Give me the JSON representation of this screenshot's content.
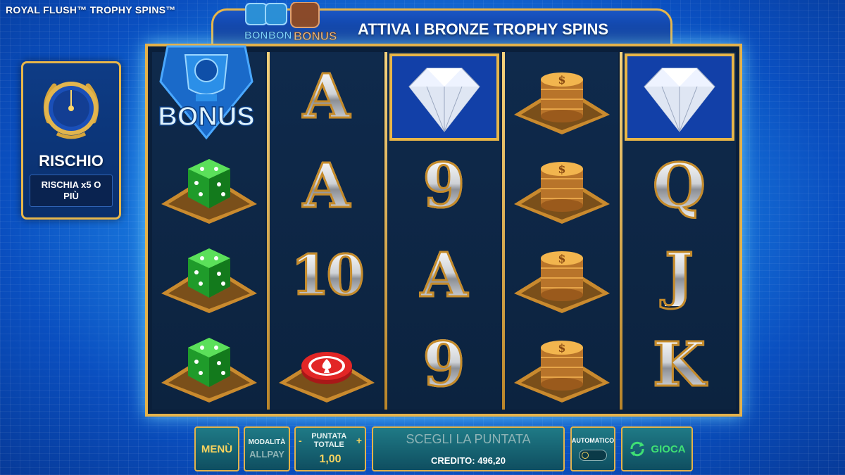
{
  "game": {
    "title": "ROYAL FLUSH™ TROPHY SPINS™"
  },
  "risk": {
    "label": "RISCHIO",
    "sub": "RISCHIA x5 O PIÙ"
  },
  "banner": {
    "text": "ATTIVA I BRONZE TROPHY SPINS",
    "logo_words": [
      "BON",
      "BON",
      "BONUS"
    ]
  },
  "reels": {
    "grid": [
      [
        "bonus-trophy",
        "green-dice",
        "green-dice",
        "green-dice"
      ],
      [
        "A",
        "A",
        "10",
        "poker-chip"
      ],
      [
        "diamond",
        "9",
        "A",
        "9"
      ],
      [
        "gold-coins",
        "gold-coins",
        "gold-coins",
        "gold-coins"
      ],
      [
        "diamond",
        "Q",
        "J",
        "K"
      ]
    ],
    "bonus_text": "BONUS"
  },
  "controls": {
    "menu_label": "MENÙ",
    "mode_label": "MODALITÀ",
    "mode_value": "ALLPAY",
    "bet_title": "PUNTATA TOTALE",
    "bet_minus": "-",
    "bet_plus": "+",
    "bet_value": "1,00",
    "choose_label": "SCEGLI LA PUNTATA",
    "credit_label": "CREDITO: 496,20",
    "auto_label": "AUTOMATICO",
    "play_label": "GIOCA"
  },
  "colors": {
    "gold": "#e5b24a",
    "play_green": "#3fe074",
    "panel_teal": "#1f7a86"
  }
}
